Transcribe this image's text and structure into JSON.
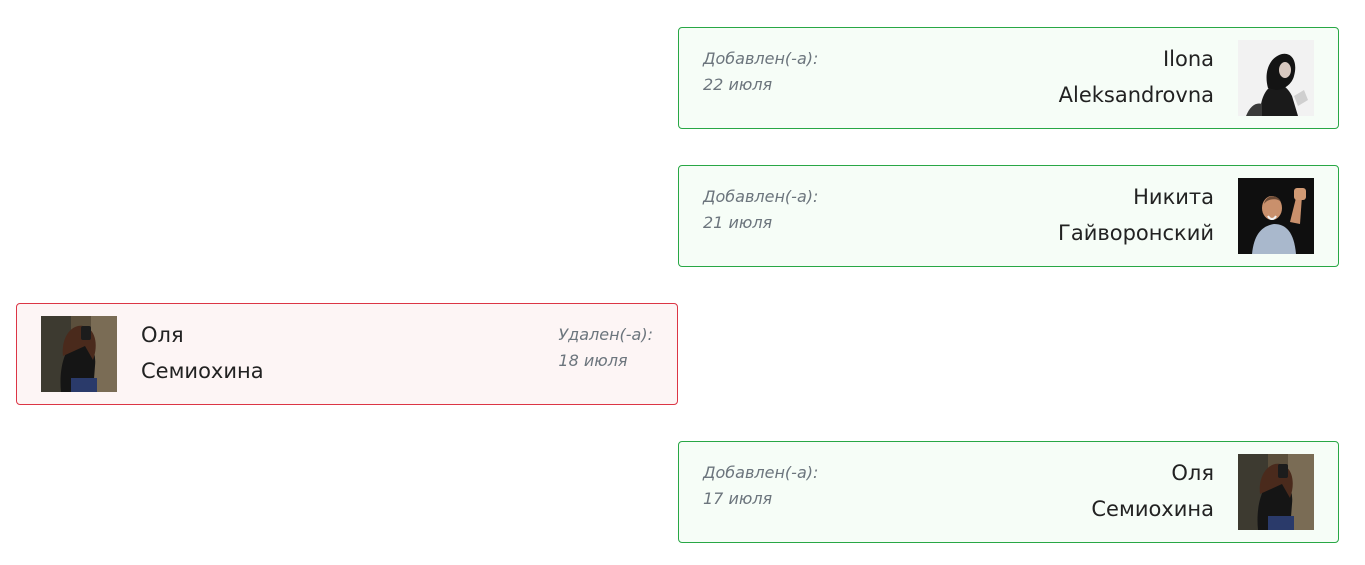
{
  "activity": [
    {
      "status": "added",
      "label": "Добавлен(-а):",
      "date": "22 июля",
      "first_name": "Ilona",
      "last_name": "Aleksandrovna",
      "avatar_icon": "user-photo-icon",
      "accent": "#28a745"
    },
    {
      "status": "added",
      "label": "Добавлен(-а):",
      "date": "21 июля",
      "first_name": "Никита",
      "last_name": "Гайворонский",
      "avatar_icon": "user-photo-icon",
      "accent": "#28a745"
    },
    {
      "status": "removed",
      "label": "Удален(-а):",
      "date": "18 июля",
      "first_name": "Оля",
      "last_name": "Семиохина",
      "avatar_icon": "user-photo-icon",
      "accent": "#dc3545"
    },
    {
      "status": "added",
      "label": "Добавлен(-а):",
      "date": "17 июля",
      "first_name": "Оля",
      "last_name": "Семиохина",
      "avatar_icon": "user-photo-icon",
      "accent": "#28a745"
    }
  ]
}
